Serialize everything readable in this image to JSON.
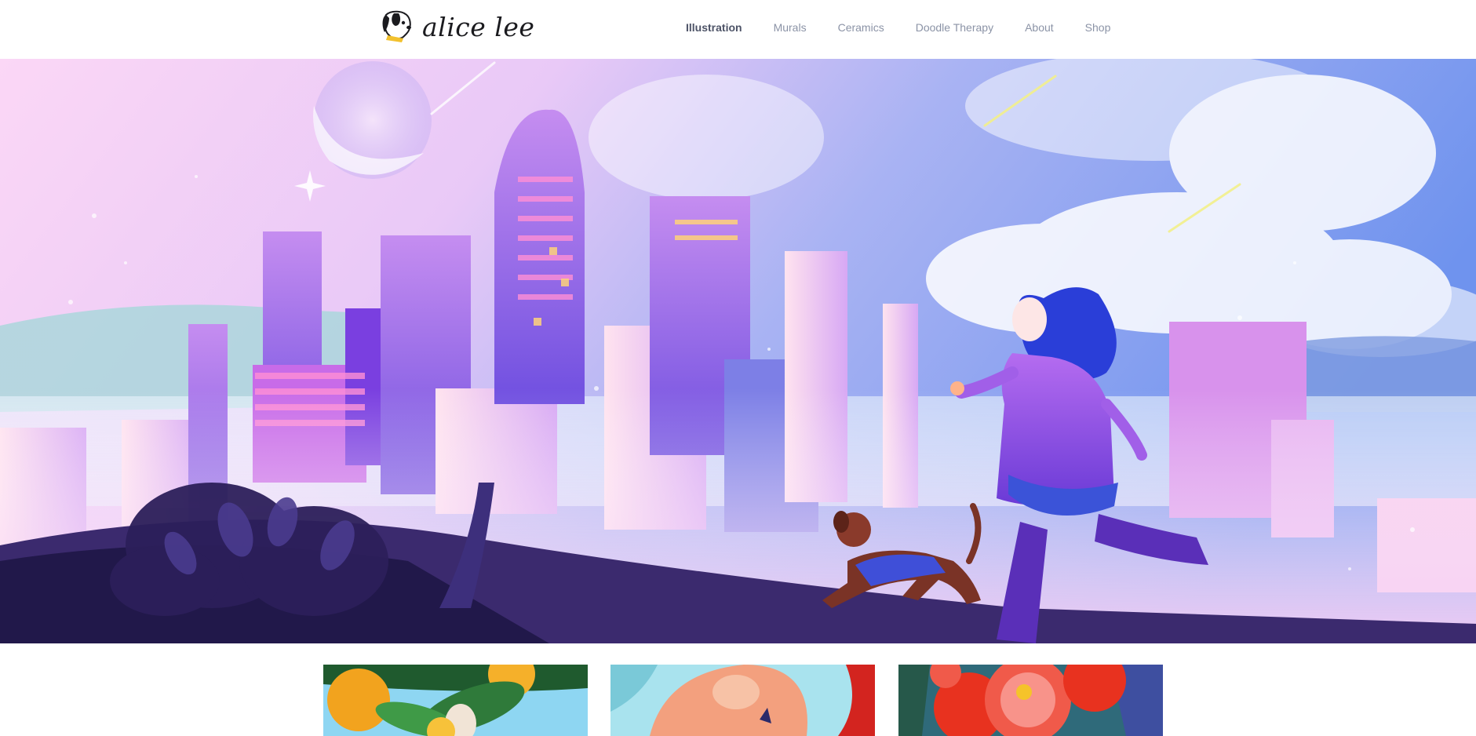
{
  "brand": {
    "name": "alice lee",
    "logo_icon": "dog-head-icon"
  },
  "nav": {
    "items": [
      {
        "label": "Illustration",
        "active": true
      },
      {
        "label": "Murals",
        "active": false
      },
      {
        "label": "Ceramics",
        "active": false
      },
      {
        "label": "Doodle Therapy",
        "active": false
      },
      {
        "label": "About",
        "active": false
      },
      {
        "label": "Shop",
        "active": false
      }
    ]
  },
  "hero": {
    "subject": "city-skyline-girl-running-with-dog-illustration"
  },
  "thumbnails": [
    {
      "subject": "oranges-and-leaves-illustration"
    },
    {
      "subject": "orange-shape-illustration"
    },
    {
      "subject": "red-flowers-illustration"
    }
  ],
  "colors": {
    "nav_text": "#8b93a6",
    "nav_active": "#4d5367",
    "brand_text": "#1b1b1f",
    "sky_pink": "#f6c6f0",
    "sky_blue": "#7f9cf0",
    "building_purple": "#9a6ee6"
  }
}
